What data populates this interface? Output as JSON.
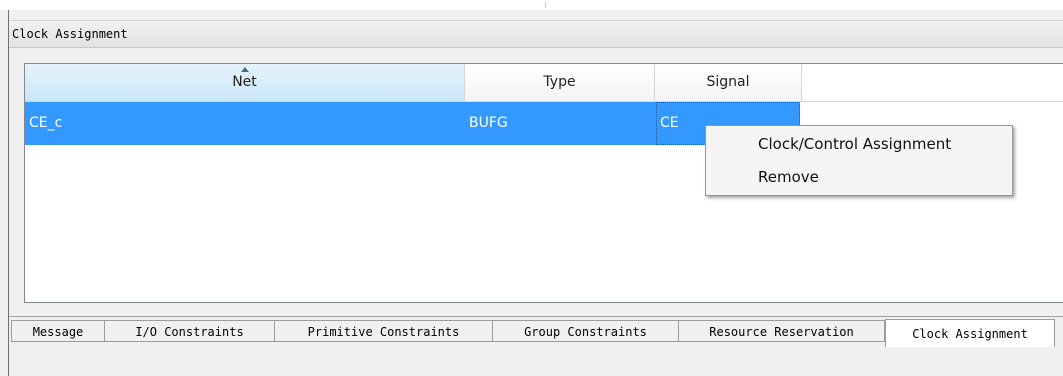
{
  "panel": {
    "title": "Clock Assignment"
  },
  "table": {
    "columns": [
      "Net",
      "Type",
      "Signal"
    ],
    "rows": [
      {
        "net": "CE_c",
        "type": "BUFG",
        "signal": "CE"
      }
    ]
  },
  "context_menu": {
    "items": [
      "Clock/Control Assignment",
      "Remove"
    ]
  },
  "tabs": [
    "Message",
    "I/O Constraints",
    "Primitive Constraints",
    "Group Constraints",
    "Resource Reservation",
    "Clock Assignment"
  ],
  "active_tab": "Clock Assignment",
  "colors": {
    "selection": "#3399ff",
    "sorted_header": "#c9e6f7",
    "background": "#f0f0f0"
  },
  "icons": {
    "sort_indicator": "sort-ascending-icon"
  }
}
